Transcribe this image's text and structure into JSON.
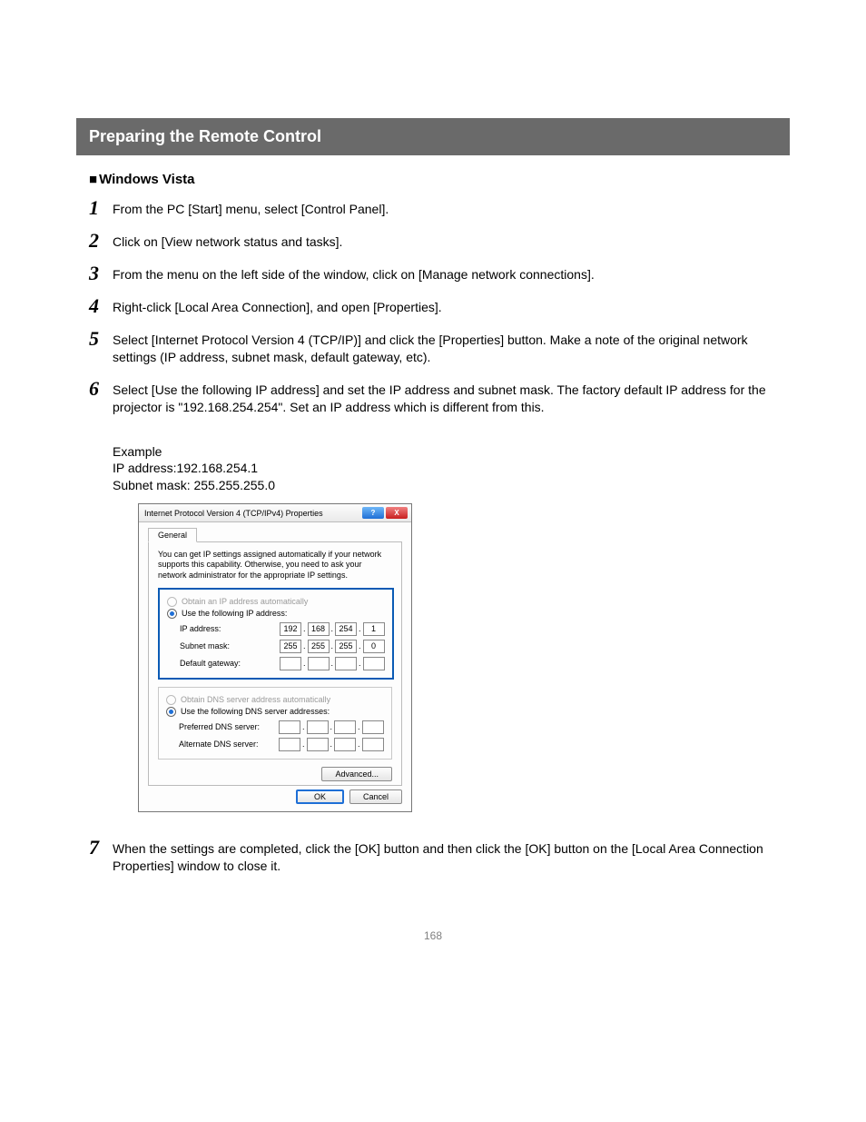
{
  "page": {
    "section_title": "Preparing the Remote Control",
    "subheading_marker": "■",
    "subheading": "Windows Vista",
    "page_number": "168"
  },
  "steps": {
    "s1": {
      "n": "1",
      "t": "From the PC [Start] menu, select [Control Panel]."
    },
    "s2": {
      "n": "2",
      "t": "Click on [View network status and tasks]."
    },
    "s3": {
      "n": "3",
      "t": "From the menu on the left side of the window, click on [Manage network connections]."
    },
    "s4": {
      "n": "4",
      "t": "Right-click [Local Area Connection], and open [Properties]."
    },
    "s5": {
      "n": "5",
      "t": "Select [Internet Protocol Version 4 (TCP/IP)] and click the [Properties] button. Make a note of the original network settings (IP address, subnet mask, default gateway, etc)."
    },
    "s6": {
      "n": "6",
      "t": "Select [Use the following IP address] and set the IP address and subnet mask. The factory default IP address for the projector is \"192.168.254.254\". Set an IP address which is different from this."
    },
    "s7": {
      "n": "7",
      "t": "When the settings are completed, click the [OK] button and then click the [OK] button on the [Local Area Connection Properties] window to close it."
    }
  },
  "example": {
    "label": "Example",
    "ip_line": "IP address:192.168.254.1",
    "mask_line": "Subnet mask: 255.255.255.0"
  },
  "dialog": {
    "title": "Internet Protocol Version 4 (TCP/IPv4) Properties",
    "help_glyph": "?",
    "close_glyph": "X",
    "tab_general": "General",
    "description": "You can get IP settings assigned automatically if your network supports this capability. Otherwise, you need to ask your network administrator for the appropriate IP settings.",
    "obtain_ip": "Obtain an IP address automatically",
    "use_ip": "Use the following IP address:",
    "ip_label": "IP address:",
    "ip_o1": "192",
    "ip_o2": "168",
    "ip_o3": "254",
    "ip_o4": "1",
    "mask_label": "Subnet mask:",
    "mk_o1": "255",
    "mk_o2": "255",
    "mk_o3": "255",
    "mk_o4": "0",
    "gw_label": "Default gateway:",
    "obtain_dns": "Obtain DNS server address automatically",
    "use_dns": "Use the following DNS server addresses:",
    "pref_dns": "Preferred DNS server:",
    "alt_dns": "Alternate DNS server:",
    "advanced": "Advanced...",
    "ok": "OK",
    "cancel": "Cancel",
    "dot": "."
  }
}
